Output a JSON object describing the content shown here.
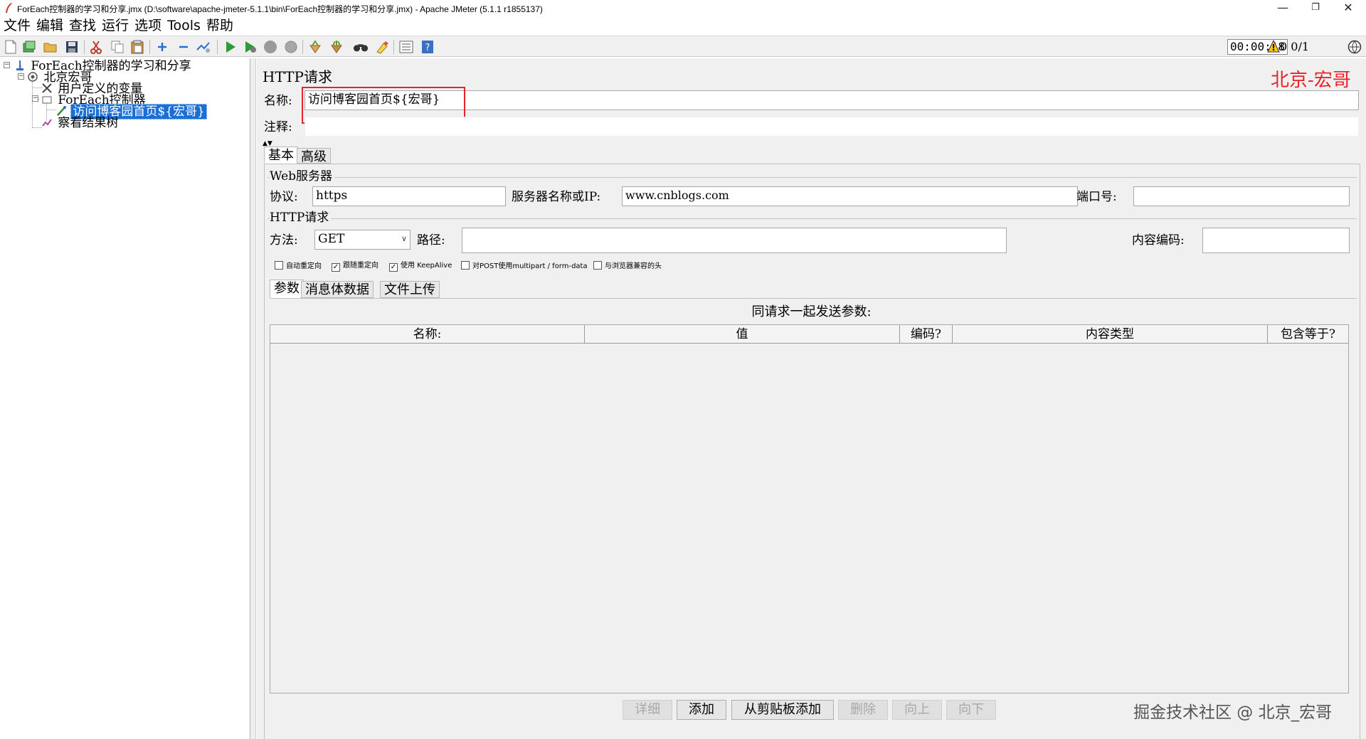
{
  "window": {
    "title": "ForEach控制器的学习和分享.jmx (D:\\software\\apache-jmeter-5.1.1\\bin\\ForEach控制器的学习和分享.jmx) - Apache JMeter (5.1.1 r1855137)",
    "minimize_icon": "minimize-icon",
    "restore_icon": "restore-icon",
    "close_icon": "close-icon"
  },
  "menu": {
    "items": [
      "文件",
      "编辑",
      "查找",
      "运行",
      "选项",
      "Tools",
      "帮助"
    ]
  },
  "toolbar": {
    "icons": [
      "new-icon",
      "templates-icon",
      "open-icon",
      "save-icon",
      "cut-icon",
      "copy-icon",
      "paste-icon",
      "expand-icon",
      "collapse-icon",
      "toggle-icon",
      "start-icon",
      "start-no-pause-icon",
      "stop-icon",
      "shutdown-icon",
      "clear-icon",
      "clear-all-icon",
      "search-icon",
      "reset-search-icon",
      "function-helper-icon",
      "help-icon"
    ],
    "timer": "00:00:18",
    "warning_count": "0",
    "threads": "0/1"
  },
  "tree": {
    "nodes": [
      {
        "label": "ForEach控制器的学习和分享",
        "icon": "test-plan-icon"
      },
      {
        "label": "北京宏哥",
        "icon": "thread-group-icon"
      },
      {
        "label": "用户定义的变量",
        "icon": "config-element-icon"
      },
      {
        "label": "ForEach控制器",
        "icon": "foreach-controller-icon"
      },
      {
        "label": "访问博客园首页${宏哥}",
        "icon": "http-sampler-icon"
      },
      {
        "label": "察看结果树",
        "icon": "result-tree-icon"
      }
    ]
  },
  "panel": {
    "header": "HTTP请求",
    "watermark": "北京-宏哥",
    "name_label": "名称:",
    "name_value": "访问博客园首页${宏哥}",
    "comment_label": "注释:",
    "comment_value": "",
    "tabs": [
      "基本",
      "高级"
    ],
    "web_server": {
      "group_title": "Web服务器",
      "protocol_label": "协议:",
      "protocol_value": "https",
      "server_label": "服务器名称或IP:",
      "server_value": "www.cnblogs.com",
      "port_label": "端口号:",
      "port_value": ""
    },
    "http_request": {
      "group_title": "HTTP请求",
      "method_label": "方法:",
      "method_value": "GET",
      "path_label": "路径:",
      "path_value": "",
      "encoding_label": "内容编码:",
      "encoding_value": ""
    },
    "checkboxes": [
      {
        "label": "自动重定向",
        "checked": false
      },
      {
        "label": "跟随重定向",
        "checked": true
      },
      {
        "label": "使用 KeepAlive",
        "checked": true
      },
      {
        "label": "对POST使用multipart / form-data",
        "checked": false
      },
      {
        "label": "与浏览器兼容的头",
        "checked": false
      }
    ],
    "sub_tabs": [
      "参数",
      "消息体数据",
      "文件上传"
    ],
    "params_title": "同请求一起发送参数:",
    "columns": [
      "名称:",
      "值",
      "编码?",
      "内容类型",
      "包含等于?"
    ],
    "buttons": [
      {
        "label": "详细",
        "enabled": false
      },
      {
        "label": "添加",
        "enabled": true
      },
      {
        "label": "从剪贴板添加",
        "enabled": true
      },
      {
        "label": "删除",
        "enabled": false
      },
      {
        "label": "向上",
        "enabled": false
      },
      {
        "label": "向下",
        "enabled": false
      }
    ],
    "bottom_watermark": "掘金技术社区 @ 北京_宏哥"
  }
}
